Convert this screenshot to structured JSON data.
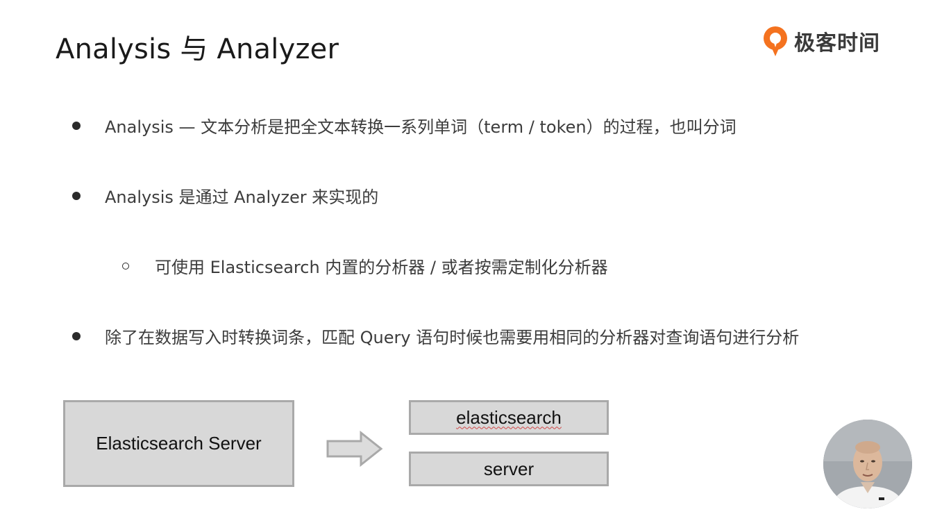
{
  "slide": {
    "title": "Analysis 与 Analyzer",
    "brand": {
      "name": "极客时间",
      "icon": "geektime-logo-icon",
      "accent": "#f4721f"
    },
    "bullets": [
      "Analysis — 文本分析是把全文本转换一系列单词（term / token）的过程，也叫分词",
      "Analysis 是通过 Analyzer 来实现的",
      "可使用 Elasticsearch 内置的分析器 / 或者按需定制化分析器",
      "除了在数据写入时转换词条，匹配 Query 语句时候也需要用相同的分析器对查询语句进行分析"
    ]
  },
  "diagram": {
    "source_text": "Elasticsearch Server",
    "arrow_icon": "right-arrow-icon",
    "tokens": [
      "elasticsearch",
      "server"
    ],
    "box_fill": "#d8d8d8",
    "box_border": "#a9a9a9"
  },
  "presenter": {
    "icon": "presenter-avatar"
  }
}
